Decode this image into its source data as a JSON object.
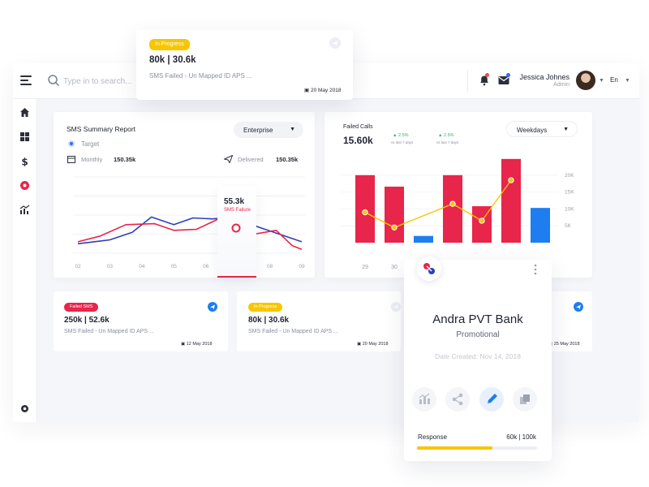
{
  "colors": {
    "accent_red": "#e8254a",
    "accent_blue": "#2e6ff0",
    "accent_yellow": "#f7c600",
    "bar_blue": "#1e7ef0",
    "line_blue": "#2e3fb8",
    "badge_yellow": "#f7c600",
    "badge_red": "#e8254a"
  },
  "header": {
    "search_placeholder": "Type in to search...",
    "user_name": "Jessica Johnes",
    "user_role": "Admin",
    "language": "En"
  },
  "sidebar": {
    "items": [
      {
        "icon": "home-icon"
      },
      {
        "icon": "dashboard-icon"
      },
      {
        "icon": "dollar-icon"
      },
      {
        "icon": "brand-icon"
      },
      {
        "icon": "analytics-icon"
      },
      {
        "icon": "settings-icon"
      }
    ]
  },
  "floating_notification": {
    "status": "In Progress",
    "value": "80k | 30.6k",
    "subtitle": "SMS Failed - Un Mapped ID APS ...",
    "date": "20 May 2018"
  },
  "sms_summary": {
    "title": "SMS Summary Report",
    "filter": "Enterprise",
    "target_label": "Target",
    "monthly_label": "Monthly",
    "monthly_value": "150.35k",
    "delivered_label": "Delivered",
    "delivered_value": "150.35k",
    "tooltip_value": "55.3k",
    "tooltip_label": "SMS Failure",
    "active_tick": "07"
  },
  "failed_calls": {
    "label": "Failed Calls",
    "value": "15.60k",
    "delta1_value": "2.5%",
    "delta1_sub": "vs last 7 days",
    "delta2_value": "2.5%",
    "delta2_sub": "vs last 7 days",
    "filter": "Weekdays"
  },
  "mini_cards": [
    {
      "status": "Failed SMS",
      "value": "250k | 52.6k",
      "subtitle": "SMS Failed - Un Mapped ID APS ...",
      "date": "12 May 2018"
    },
    {
      "status": "In Progress",
      "value": "80k | 30.6k",
      "subtitle": "SMS Failed - Un Mapped ID APS ...",
      "date": "20 May 2018"
    },
    {
      "date": "25 May 2018"
    }
  ],
  "bank_card": {
    "name": "Andra PVT Bank",
    "type": "Promotional",
    "date_created": "Date Created: Nov 14, 2018",
    "response_label": "Response",
    "response_value": "60k | 100k",
    "response_progress": 0.63
  },
  "chart_data": [
    {
      "type": "line",
      "x": [
        "02",
        "03",
        "04",
        "05",
        "06",
        "07",
        "08",
        "09"
      ],
      "x_positions": [
        2,
        3,
        4,
        5,
        6,
        7,
        8,
        9
      ],
      "series": [
        {
          "color": "#2e3fb8",
          "points": [
            [
              2,
              10
            ],
            [
              3,
              14
            ],
            [
              3.7,
              22
            ],
            [
              4.3,
              38
            ],
            [
              5,
              30
            ],
            [
              5.6,
              37
            ],
            [
              6.2,
              36
            ],
            [
              7,
              38
            ],
            [
              7.6,
              28
            ],
            [
              8.3,
              20
            ],
            [
              9,
              12
            ]
          ]
        },
        {
          "color": "#e8254a",
          "points": [
            [
              2,
              12
            ],
            [
              2.7,
              18
            ],
            [
              3.5,
              30
            ],
            [
              4.4,
              31
            ],
            [
              5,
              24
            ],
            [
              5.7,
              25
            ],
            [
              6.4,
              36
            ],
            [
              7,
              36
            ],
            [
              7.5,
              20
            ],
            [
              8.2,
              24
            ],
            [
              8.7,
              8
            ],
            [
              9,
              4
            ]
          ]
        }
      ],
      "ylim": [
        0,
        80
      ],
      "grid": true
    },
    {
      "type": "bar",
      "categories": [
        "28",
        "29",
        "30",
        "31",
        "01",
        "02",
        "03"
      ],
      "visible_x_labels": [
        "29",
        "30"
      ],
      "values": [
        20,
        16.6,
        2,
        20,
        10.8,
        24.8,
        10.3
      ],
      "bar_colors": [
        "#e8254a",
        "#e8254a",
        "#1e7ef0",
        "#e8254a",
        "#e8254a",
        "#e8254a",
        "#1e7ef0"
      ],
      "line_values": [
        9,
        4.5,
        null,
        11.5,
        6.5,
        18.5,
        null
      ],
      "yticks": [
        "20K",
        "15K",
        "10K",
        "5K"
      ],
      "ylim": [
        0,
        25
      ]
    }
  ]
}
